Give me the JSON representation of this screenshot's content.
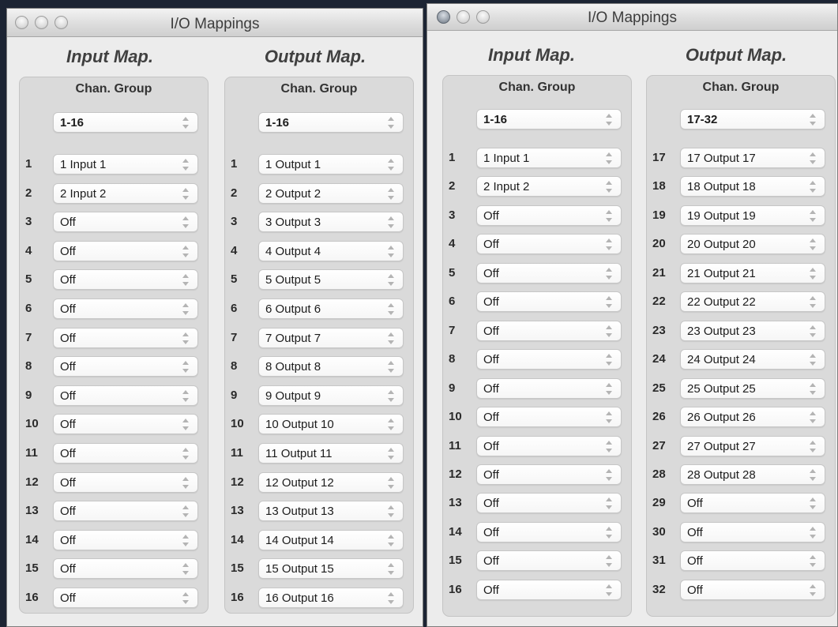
{
  "windows": [
    {
      "title": "I/O Mappings",
      "input": {
        "heading": "Input Map.",
        "group_label": "Chan. Group",
        "group_value": "1-16",
        "rows": [
          {
            "num": "1",
            "value": "1 Input 1"
          },
          {
            "num": "2",
            "value": "2 Input 2"
          },
          {
            "num": "3",
            "value": "Off"
          },
          {
            "num": "4",
            "value": "Off"
          },
          {
            "num": "5",
            "value": "Off"
          },
          {
            "num": "6",
            "value": "Off"
          },
          {
            "num": "7",
            "value": "Off"
          },
          {
            "num": "8",
            "value": "Off"
          },
          {
            "num": "9",
            "value": "Off"
          },
          {
            "num": "10",
            "value": "Off"
          },
          {
            "num": "11",
            "value": "Off"
          },
          {
            "num": "12",
            "value": "Off"
          },
          {
            "num": "13",
            "value": "Off"
          },
          {
            "num": "14",
            "value": "Off"
          },
          {
            "num": "15",
            "value": "Off"
          },
          {
            "num": "16",
            "value": "Off"
          }
        ]
      },
      "output": {
        "heading": "Output Map.",
        "group_label": "Chan. Group",
        "group_value": "1-16",
        "rows": [
          {
            "num": "1",
            "value": "1 Output 1"
          },
          {
            "num": "2",
            "value": "2 Output 2"
          },
          {
            "num": "3",
            "value": "3 Output 3"
          },
          {
            "num": "4",
            "value": "4 Output 4"
          },
          {
            "num": "5",
            "value": "5 Output 5"
          },
          {
            "num": "6",
            "value": "6 Output 6"
          },
          {
            "num": "7",
            "value": "7 Output 7"
          },
          {
            "num": "8",
            "value": "8 Output 8"
          },
          {
            "num": "9",
            "value": "9 Output 9"
          },
          {
            "num": "10",
            "value": "10 Output 10"
          },
          {
            "num": "11",
            "value": "11 Output 11"
          },
          {
            "num": "12",
            "value": "12 Output 12"
          },
          {
            "num": "13",
            "value": "13 Output 13"
          },
          {
            "num": "14",
            "value": "14 Output 14"
          },
          {
            "num": "15",
            "value": "15 Output 15"
          },
          {
            "num": "16",
            "value": "16 Output 16"
          }
        ]
      }
    },
    {
      "title": "I/O Mappings",
      "input": {
        "heading": "Input Map.",
        "group_label": "Chan. Group",
        "group_value": "1-16",
        "rows": [
          {
            "num": "1",
            "value": "1 Input 1"
          },
          {
            "num": "2",
            "value": "2 Input 2"
          },
          {
            "num": "3",
            "value": "Off"
          },
          {
            "num": "4",
            "value": "Off"
          },
          {
            "num": "5",
            "value": "Off"
          },
          {
            "num": "6",
            "value": "Off"
          },
          {
            "num": "7",
            "value": "Off"
          },
          {
            "num": "8",
            "value": "Off"
          },
          {
            "num": "9",
            "value": "Off"
          },
          {
            "num": "10",
            "value": "Off"
          },
          {
            "num": "11",
            "value": "Off"
          },
          {
            "num": "12",
            "value": "Off"
          },
          {
            "num": "13",
            "value": "Off"
          },
          {
            "num": "14",
            "value": "Off"
          },
          {
            "num": "15",
            "value": "Off"
          },
          {
            "num": "16",
            "value": "Off"
          }
        ]
      },
      "output": {
        "heading": "Output Map.",
        "group_label": "Chan. Group",
        "group_value": "17-32",
        "rows": [
          {
            "num": "17",
            "value": "17 Output 17"
          },
          {
            "num": "18",
            "value": "18 Output 18"
          },
          {
            "num": "19",
            "value": "19 Output 19"
          },
          {
            "num": "20",
            "value": "20 Output 20"
          },
          {
            "num": "21",
            "value": "21 Output 21"
          },
          {
            "num": "22",
            "value": "22 Output 22"
          },
          {
            "num": "23",
            "value": "23 Output 23"
          },
          {
            "num": "24",
            "value": "24 Output 24"
          },
          {
            "num": "25",
            "value": "25 Output 25"
          },
          {
            "num": "26",
            "value": "26 Output 26"
          },
          {
            "num": "27",
            "value": "27 Output 27"
          },
          {
            "num": "28",
            "value": "28 Output 28"
          },
          {
            "num": "29",
            "value": "Off"
          },
          {
            "num": "30",
            "value": "Off"
          },
          {
            "num": "31",
            "value": "Off"
          },
          {
            "num": "32",
            "value": "Off"
          }
        ]
      }
    }
  ]
}
